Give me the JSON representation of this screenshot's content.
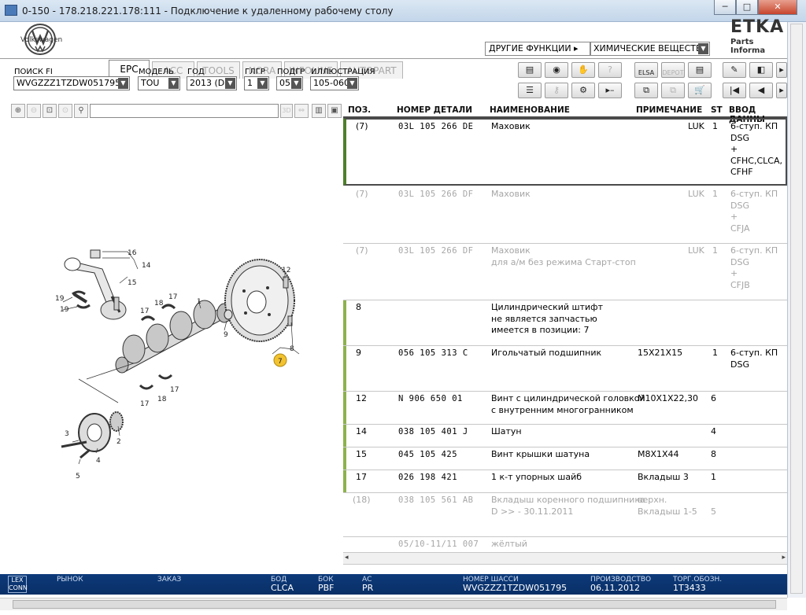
{
  "window": {
    "title": "0-150 - 178.218.221.178:111 - Подключение к удаленному рабочему столу",
    "min_label": "─",
    "max_label": "□",
    "close_label": "✕"
  },
  "brand": {
    "vw_label": "Volkswagen",
    "etka": "ETKA",
    "etka_sub": "Parts Informa"
  },
  "tabs": [
    {
      "label": "EPC"
    },
    {
      "label": "ACC"
    },
    {
      "label": "TOOLS"
    },
    {
      "label": "NORA"
    },
    {
      "label": "INFOLINE"
    },
    {
      "label": "AUTOPART"
    }
  ],
  "functions": {
    "label": "ДРУГИЕ ФУНКЦИИ ▸",
    "selected": "ХИМИЧЕСКИЕ ВЕЩЕСТВА"
  },
  "filters": {
    "fi_label": "ПОИСК FI",
    "fi_value": "WVGZZZ1TZDW051795",
    "model_label": "МОДЕЛЬ",
    "model_value": "TOU",
    "year_label": "ГОД",
    "year_value": "2013 (D)",
    "hg_label": "ГЛГР",
    "hg_value": "1",
    "ug_label": "ПОДГР",
    "ug_value": "05",
    "ill_label": "ИЛЛЮСТРАЦИЯ",
    "ill_value": "105-060"
  },
  "toolbar": {
    "elsa": "ELSA",
    "depot": "DEPOT",
    "first": "|◀",
    "prev": "◀",
    "pin": "✎",
    "fax": "▤",
    "cart": "🛒"
  },
  "diagram_toolbar": {
    "btn3d": "3D"
  },
  "diagram_labels": {
    "c1": "1",
    "c2": "2",
    "c3": "3",
    "c4": "4",
    "c5": "5",
    "c7": "7",
    "c8": "8",
    "c9": "9",
    "c12": "12",
    "c14": "14",
    "c15": "15",
    "c16": "16",
    "c17": "17",
    "c18": "18",
    "c19": "19"
  },
  "table": {
    "headers": {
      "pos": "ПОЗ.",
      "part": "НОМЕР ДЕТАЛИ",
      "name": "НАИМЕНОВАНИЕ",
      "note": "ПРИМЕЧАНИЕ",
      "st": "ST",
      "input": "ВВОД ДАННЫ"
    },
    "rows": [
      {
        "pos": "(7)",
        "part": "03L 105 266 DE",
        "name": "Маховик",
        "note": "LUK",
        "st": "1",
        "input": "6-ступ. КП\nDSG\n+\nCFHC,CLCA,\nCFHF"
      },
      {
        "pos": "(7)",
        "part": "03L 105 266 DF",
        "name": "Маховик",
        "note": "LUK",
        "st": "1",
        "input": "6-ступ. КП\nDSG\n+\nCFJA"
      },
      {
        "pos": "(7)",
        "part": "03L 105 266 DF",
        "name": "Маховик\nдля а/м без режима Старт-стоп",
        "note": "LUK",
        "st": "1",
        "input": "6-ступ. КП\nDSG\n+\nCFJB"
      },
      {
        "pos": "8",
        "part": "",
        "name": "Цилиндрический штифт\nне является запчастью\n        имеется в позиции:  7",
        "note": "",
        "st": "",
        "input": ""
      },
      {
        "pos": "9",
        "part": "056 105 313 C",
        "name": "Игольчатый подшипник",
        "note": "15X21X15",
        "st": "1",
        "input": "6-ступ. КП\nDSG"
      },
      {
        "pos": "12",
        "part": "N    906 650 01",
        "name": "Винт с цилиндрической головкой\nс внутренним многогранником",
        "note": "M10X1X22,30",
        "st": "6",
        "input": ""
      },
      {
        "pos": "14",
        "part": "038 105 401 J",
        "name": "Шатун",
        "note": "",
        "st": "4",
        "input": ""
      },
      {
        "pos": "15",
        "part": "045 105 425",
        "name": "Винт крышки шатуна",
        "note": "M8X1X44",
        "st": "8",
        "input": ""
      },
      {
        "pos": "17",
        "part": "026 198 421",
        "name": "1 к-т упорных шайб",
        "note": "Вкладыш 3",
        "st": "1",
        "input": ""
      },
      {
        "pos": "(18)",
        "part": "038 105 561 AB",
        "name": "Вкладыш коренного подшипника\nD            >> - 30.11.2011",
        "note": "верхн.\nВкладыш 1-5",
        "st": "\n5",
        "input": ""
      },
      {
        "pos": "",
        "part": "05/10-11/11 007",
        "name": "жёлтый",
        "note": "",
        "st": "",
        "input": ""
      }
    ]
  },
  "footer": {
    "logo": "LEX CONN",
    "market_label": "РЫНОК",
    "order_label": "ЗАКАЗ",
    "bod_label": "БОД",
    "bod_value": "CLCA",
    "bok_label": "БОК",
    "bok_value": "PBF",
    "ac_label": "АС",
    "ac_value": "PR",
    "chassis_label": "НОМЕР ШАССИ",
    "chassis_value": "WVGZZZ1TZDW051795",
    "prod_label": "ПРОИЗВОДСТВО",
    "prod_value": "06.11.2012",
    "trade_label": "ТОРГ.ОБОЗН.",
    "trade_value": "1T3433"
  }
}
